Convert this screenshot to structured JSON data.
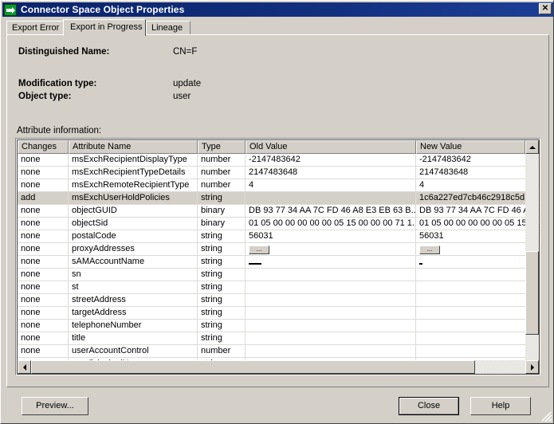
{
  "window": {
    "title": "Connector Space Object Properties",
    "icon": "connector-object-icon",
    "close_label": "✕"
  },
  "tabs": [
    {
      "label": "Export Error",
      "active": false
    },
    {
      "label": "Export in Progress",
      "active": true
    },
    {
      "label": "Lineage",
      "active": false
    }
  ],
  "details": {
    "dn_label": "Distinguished Name:",
    "dn_value": "CN=F",
    "modification_type_label": "Modification type:",
    "modification_type_value": "update",
    "object_type_label": "Object type:",
    "object_type_value": "user",
    "attribute_info_label": "Attribute information:"
  },
  "grid": {
    "columns": [
      "Changes",
      "Attribute Name",
      "Type",
      "Old Value",
      "New Value"
    ],
    "rows": [
      {
        "changes": "none",
        "attribute": "msExchRecipientDisplayType",
        "type": "number",
        "old": "-2147483642",
        "new": "-2147483642",
        "selected": false
      },
      {
        "changes": "none",
        "attribute": "msExchRecipientTypeDetails",
        "type": "number",
        "old": "2147483648",
        "new": "2147483648",
        "selected": false
      },
      {
        "changes": "none",
        "attribute": "msExchRemoteRecipientType",
        "type": "number",
        "old": "4",
        "new": "4",
        "selected": false
      },
      {
        "changes": "add",
        "attribute": "msExchUserHoldPolicies",
        "type": "string",
        "old": "",
        "new": "1c6a227ed7cb46c2918c5d",
        "selected": true
      },
      {
        "changes": "none",
        "attribute": "objectGUID",
        "type": "binary",
        "old": "DB 93 77 34 AA 7C FD 46 A8 E3 EB 63 B...",
        "new": "DB 93 77 34 AA 7C FD 46 A",
        "selected": false
      },
      {
        "changes": "none",
        "attribute": "objectSid",
        "type": "binary",
        "old": "01 05 00 00 00 00 00 05 15 00 00 00 71 1...",
        "new": "01 05 00 00 00 00 00 05 15",
        "selected": false
      },
      {
        "changes": "none",
        "attribute": "postalCode",
        "type": "string",
        "old": "56031",
        "new": "56031",
        "selected": false
      },
      {
        "changes": "none",
        "attribute": "proxyAddresses",
        "type": "string",
        "old": "...",
        "new": "...",
        "old_is_button": true,
        "new_is_button": true,
        "selected": false
      },
      {
        "changes": "none",
        "attribute": "sAMAccountName",
        "type": "string",
        "old": "",
        "new": "",
        "old_redacted": true,
        "new_redacted": true,
        "selected": false
      },
      {
        "changes": "none",
        "attribute": "sn",
        "type": "string",
        "old": "",
        "new": "",
        "selected": false
      },
      {
        "changes": "none",
        "attribute": "st",
        "type": "string",
        "old": "",
        "new": "",
        "selected": false
      },
      {
        "changes": "none",
        "attribute": "streetAddress",
        "type": "string",
        "old": "",
        "new": "",
        "selected": false
      },
      {
        "changes": "none",
        "attribute": "targetAddress",
        "type": "string",
        "old": "",
        "new": "",
        "selected": false
      },
      {
        "changes": "none",
        "attribute": "telephoneNumber",
        "type": "string",
        "old": "",
        "new": "",
        "selected": false
      },
      {
        "changes": "none",
        "attribute": "title",
        "type": "string",
        "old": "",
        "new": "",
        "selected": false
      },
      {
        "changes": "none",
        "attribute": "userAccountControl",
        "type": "number",
        "old": "",
        "new": "",
        "selected": false
      },
      {
        "changes": "none",
        "attribute": "userPrincipalName",
        "type": "string",
        "old": "",
        "new": "",
        "selected": false
      },
      {
        "changes": "",
        "attribute": "",
        "type": "",
        "old": "",
        "new": "",
        "selected": false
      }
    ]
  },
  "buttons": {
    "preview": "Preview...",
    "close": "Close",
    "help": "Help"
  },
  "colors": {
    "titlebar_start": "#0a246a",
    "titlebar_end": "#1c3f96",
    "face": "#d4d0c8",
    "selection": "#d4d0c8",
    "icon_green": "#0a9a2e"
  }
}
